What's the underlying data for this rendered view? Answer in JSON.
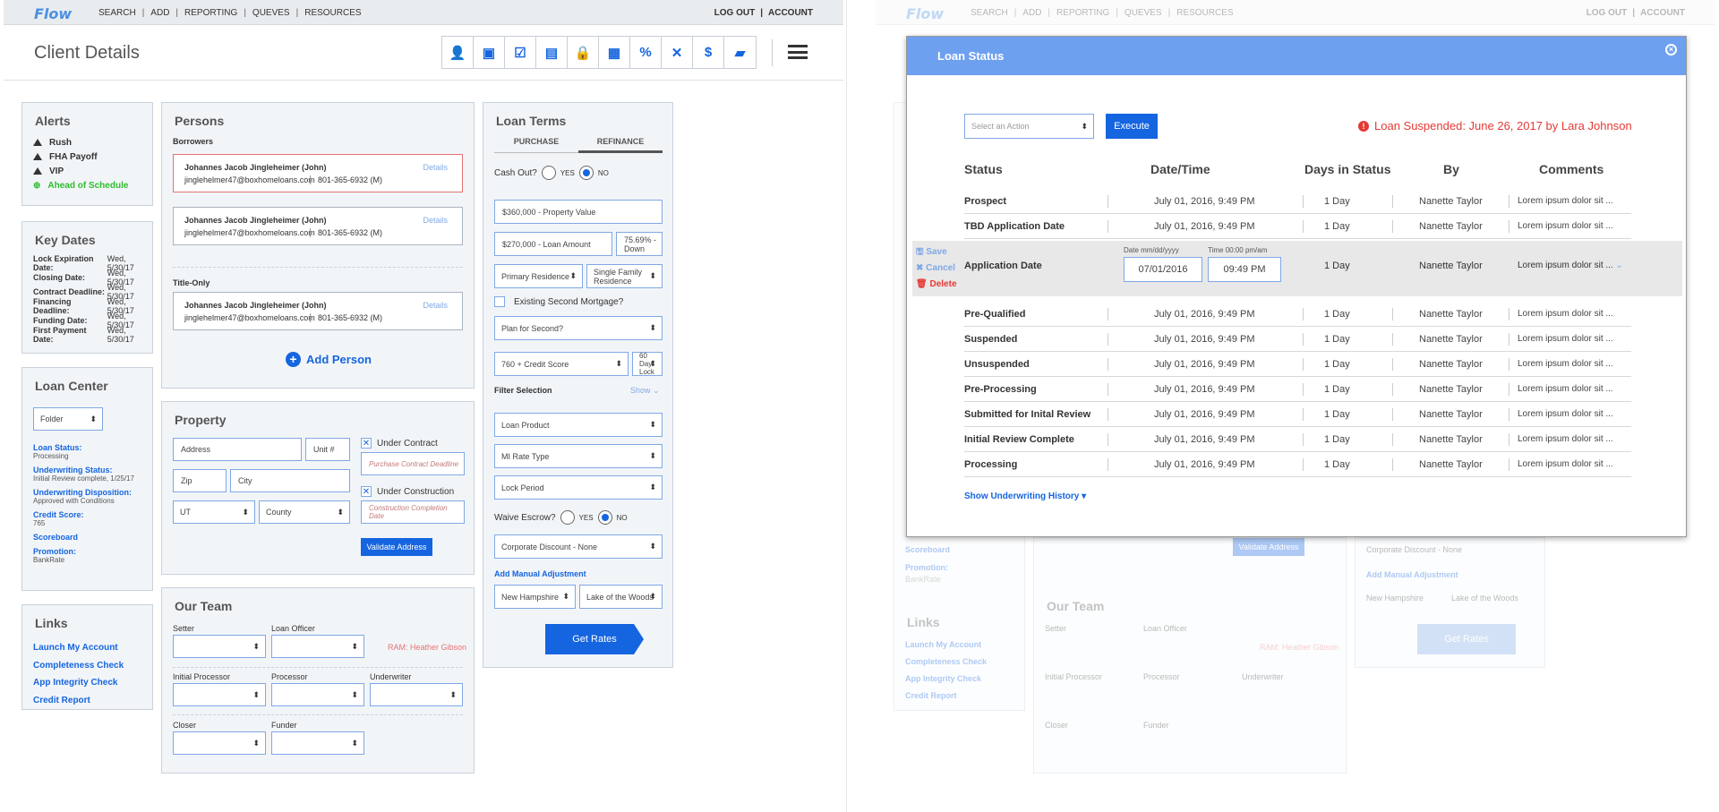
{
  "app": {
    "logo": "Flow",
    "nav": [
      "SEARCH",
      "ADD",
      "REPORTING",
      "QUEVES",
      "RESOURCES"
    ],
    "logout": "LOG OUT",
    "account": "ACCOUNT",
    "page_title": "Client Details"
  },
  "toolbar_icons": [
    "person-icon",
    "money-icon",
    "checklist-icon",
    "document-icon",
    "lock-icon",
    "book-icon",
    "percent-icon",
    "x-logo-icon",
    "dollar-icon",
    "briefcase-icon"
  ],
  "toolbar_glyphs": [
    "👤",
    "▣",
    "☑",
    "▤",
    "🔒",
    "▦",
    "%",
    "✕",
    "$",
    "▰"
  ],
  "alerts": {
    "title": "Alerts",
    "items": [
      {
        "label": "Rush",
        "kind": "warning"
      },
      {
        "label": "FHA Payoff",
        "kind": "warning"
      },
      {
        "label": "VIP",
        "kind": "warning"
      },
      {
        "label": "Ahead of Schedule",
        "kind": "ok"
      }
    ]
  },
  "key_dates": {
    "title": "Key Dates",
    "items": [
      {
        "label": "Lock Expiration Date:",
        "value": "Wed, 5/30/17"
      },
      {
        "label": "Closing Date:",
        "value": "Wed, 5/30/17"
      },
      {
        "label": "Contract Deadline:",
        "value": "Wed, 5/30/17"
      },
      {
        "label": "Financing Deadline:",
        "value": "Wed, 5/30/17"
      },
      {
        "label": "Funding Date:",
        "value": "Wed, 5/30/17"
      },
      {
        "label": "First Payment Date:",
        "value": "Wed, 5/30/17"
      }
    ]
  },
  "loan_center": {
    "title": "Loan Center",
    "folder": "Folder",
    "items": [
      {
        "label": "Loan Status:",
        "value": "Processing"
      },
      {
        "label": "Underwriting Status:",
        "value": "Initial Review complete, 1/25/17"
      },
      {
        "label": "Underwriting Disposition:",
        "value": "Approved with Conditions"
      },
      {
        "label": "Credit Score:",
        "value": "765"
      },
      {
        "label": "Scoreboard",
        "value": ""
      },
      {
        "label": "Promotion:",
        "value": "BankRate"
      }
    ]
  },
  "links": {
    "title": "Links",
    "items": [
      "Launch My Account",
      "Completeness Check",
      "App Integrity Check",
      "Credit Report"
    ]
  },
  "persons": {
    "title": "Persons",
    "borrowers_label": "Borrowers",
    "title_only_label": "Title-Only",
    "details": "Details",
    "borrowers": [
      {
        "name": "Johannes Jacob Jingleheimer (John)",
        "email": "jinglehelmer47@boxhomeloans.com",
        "phone": "801-365-6932 (M)"
      },
      {
        "name": "Johannes Jacob Jingleheimer (John)",
        "email": "jinglehelmer47@boxhomeloans.com",
        "phone": "801-365-6932 (M)"
      }
    ],
    "title_only": [
      {
        "name": "Johannes Jacob Jingleheimer (John)",
        "email": "jinglehelmer47@boxhomeloans.com",
        "phone": "801-365-6932 (M)"
      }
    ],
    "add_person": "Add Person"
  },
  "property": {
    "title": "Property",
    "address": "Address",
    "unit": "Unit #",
    "zip": "Zip",
    "city": "City",
    "state": "UT",
    "county": "County",
    "under_contract": "Under Contract",
    "contract_ph": "Purchase Contract Deadline",
    "under_construction": "Under Construction",
    "construction_ph": "Construction Completion Date",
    "validate": "Validate Address"
  },
  "team": {
    "title": "Our Team",
    "setter": "Setter",
    "loan_officer": "Loan Officer",
    "ram": "RAM: Heather Gibson",
    "initial_processor": "Initial Processor",
    "processor": "Processor",
    "underwriter": "Underwriter",
    "closer": "Closer",
    "funder": "Funder"
  },
  "loan_terms": {
    "title": "Loan Terms",
    "tabs": [
      "PURCHASE",
      "REFINANCE"
    ],
    "cash_out": "Cash Out?",
    "yes": "YES",
    "no": "NO",
    "property_value": "$360,000 - Property Value",
    "loan_amount": "$270,000 - Loan Amount",
    "down": "75.69% - Down",
    "occupancy": "Primary Residence",
    "property_type": "Single Family Residence",
    "second_mortgage": "Existing Second Mortgage?",
    "plan_second": "Plan for Second?",
    "credit_score": "760 + Credit Score",
    "lock_days": "60 Day Lock",
    "filter": "Filter Selection",
    "show": "Show",
    "loan_product": "Loan Product",
    "mi_rate": "MI Rate Type",
    "lock_period": "Lock Period",
    "waive_escrow": "Waive Escrow?",
    "discount": "Corporate Discount - None",
    "manual_adj": "Add Manual Adjustment",
    "state": "New Hampshire",
    "county": "Lake of the Woods",
    "get_rates": "Get Rates"
  },
  "modal": {
    "title": "Loan Status",
    "action_ph": "Select an Action",
    "execute": "Execute",
    "suspended": "Loan Suspended: June 26, 2017 by Lara Johnson",
    "columns": [
      "Status",
      "Date/Time",
      "Days in Status",
      "By",
      "Comments"
    ],
    "rows": [
      {
        "status": "Prospect",
        "date": "July 01, 2016, 9:49 PM",
        "days": "1 Day",
        "by": "Nanette Taylor",
        "comment": "Lorem ipsum dolor sit ..."
      },
      {
        "status": "TBD Application Date",
        "date": "July 01, 2016, 9:49 PM",
        "days": "1 Day",
        "by": "Nanette Taylor",
        "comment": "Lorem ipsum dolor sit ..."
      }
    ],
    "edit_row": {
      "status": "Application Date",
      "date_label": "Date mm/dd/yyyy",
      "date": "07/01/2016",
      "time_label": "Time 00:00 pm/am",
      "time": "09:49 PM",
      "days": "1 Day",
      "by": "Nanette Taylor",
      "comment": "Lorem ipsum dolor sit ...",
      "save": "Save",
      "cancel": "Cancel",
      "delete": "Delete"
    },
    "rows2": [
      {
        "status": "Pre-Qualified",
        "date": "July 01, 2016, 9:49 PM",
        "days": "1 Day",
        "by": "Nanette Taylor",
        "comment": "Lorem ipsum dolor sit ..."
      },
      {
        "status": "Suspended",
        "date": "July 01, 2016, 9:49 PM",
        "days": "1 Day",
        "by": "Nanette Taylor",
        "comment": "Lorem ipsum dolor sit ..."
      },
      {
        "status": "Unsuspended",
        "date": "July 01, 2016, 9:49 PM",
        "days": "1 Day",
        "by": "Nanette Taylor",
        "comment": "Lorem ipsum dolor sit ..."
      },
      {
        "status": "Pre-Processing",
        "date": "July 01, 2016, 9:49 PM",
        "days": "1 Day",
        "by": "Nanette Taylor",
        "comment": "Lorem ipsum dolor sit ..."
      },
      {
        "status": "Submitted for Inital Review",
        "date": "July 01, 2016, 9:49 PM",
        "days": "1 Day",
        "by": "Nanette Taylor",
        "comment": "Lorem ipsum dolor sit ..."
      },
      {
        "status": "Initial Review Complete",
        "date": "July 01, 2016, 9:49 PM",
        "days": "1 Day",
        "by": "Nanette Taylor",
        "comment": "Lorem ipsum dolor sit ..."
      },
      {
        "status": "Processing",
        "date": "July 01, 2016, 9:49 PM",
        "days": "1 Day",
        "by": "Nanette Taylor",
        "comment": "Lorem ipsum dolor sit ..."
      }
    ],
    "show_history": "Show Underwriting History"
  },
  "colors": {
    "brand_blue": "#1565e0",
    "modal_header": "#6ea0f0",
    "alert_red": "#e53935",
    "ok_green": "#2ebd2e"
  }
}
